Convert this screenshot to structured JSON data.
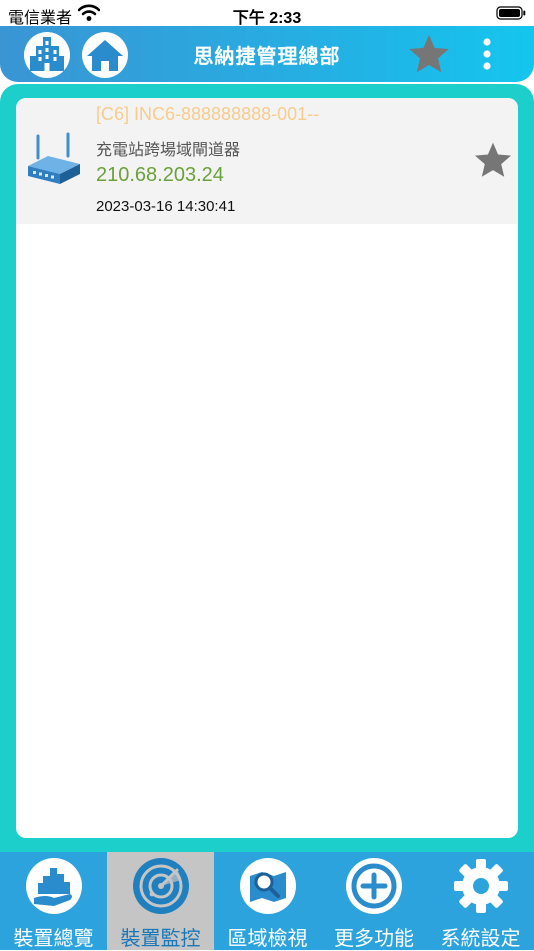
{
  "status_bar": {
    "carrier": "電信業者",
    "time": "下午 2:33"
  },
  "header": {
    "title": "思納捷管理總部",
    "left_icons": [
      "building-icon",
      "home-icon"
    ],
    "right_icons": [
      "star-icon",
      "more-vertical-icon"
    ]
  },
  "devices": [
    {
      "title": "[C6] INC6-888888888-001--",
      "type": "充電站跨場域閘道器",
      "ip": "210.68.203.24",
      "timestamp": "2023-03-16 14:30:41",
      "icon": "router-icon",
      "favorite_icon": "star-icon"
    }
  ],
  "tabs": [
    {
      "label": "裝置總覽",
      "icon": "city-hand-icon",
      "active": false
    },
    {
      "label": "裝置監控",
      "icon": "radar-icon",
      "active": true
    },
    {
      "label": "區域檢視",
      "icon": "map-search-icon",
      "active": false
    },
    {
      "label": "更多功能",
      "icon": "plus-circle-icon",
      "active": false
    },
    {
      "label": "系統設定",
      "icon": "gear-icon",
      "active": false
    }
  ],
  "colors": {
    "header_start": "#3a95d3",
    "header_end": "#14c6ee",
    "frame": "#1ccfcb",
    "title_text": "#f7cc8c",
    "ip_text": "#6aa13a",
    "tab_bar": "#2ca3dd",
    "tab_active": "#c5c5c5",
    "star": "#767676"
  }
}
